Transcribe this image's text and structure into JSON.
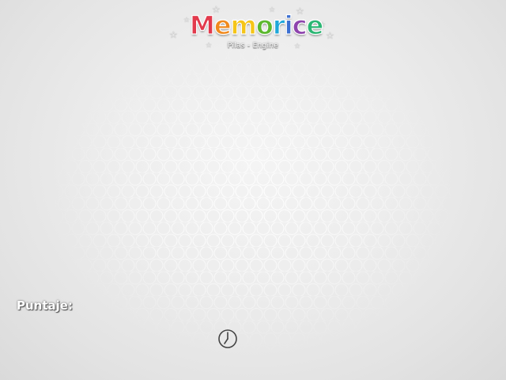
{
  "game": {
    "title": "Memorice",
    "title_colors": [
      "#e23a4c",
      "#f08a1e",
      "#f5c518",
      "#5cb82f",
      "#1fa7d9",
      "#3c6fd1",
      "#8e44ad",
      "#2bb673"
    ],
    "subtitle": "Pilas - Engine"
  },
  "hud": {
    "score_label": "Puntaje:",
    "timer_icon": "clock-icon"
  },
  "theme": {
    "background": "#e8e8e8",
    "hex_pattern": "#ffffff",
    "icon_stroke": "#444444"
  }
}
